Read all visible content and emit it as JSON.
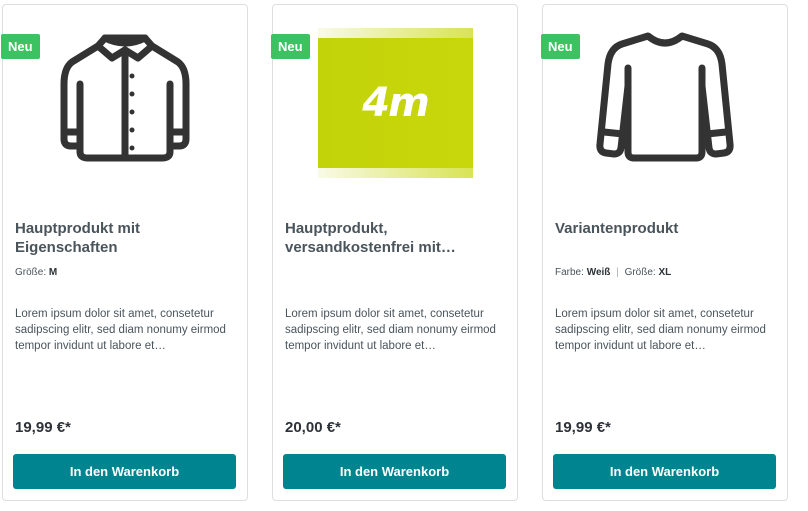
{
  "badge_label": "Neu",
  "buy_button_label": "In den Warenkorb",
  "colors": {
    "badge": "#3cc261",
    "button": "#008490",
    "logo_background": "#c3d30a"
  },
  "products": [
    {
      "title": "Hauptprodukt mit Eigenschaften",
      "icon": "jacket-icon",
      "properties": [
        {
          "label": "Größe:",
          "value": "M"
        }
      ],
      "description": "Lorem ipsum dolor sit amet, consetetur sadipscing elitr, sed diam nonumy eirmod tempor invidunt ut labore et…",
      "price": "19,99 €*"
    },
    {
      "title": "Hauptprodukt, versandkostenfrei mit…",
      "icon": "brand-logo-image",
      "logo_text": "4m",
      "properties": [],
      "description": "Lorem ipsum dolor sit amet, consetetur sadipscing elitr, sed diam nonumy eirmod tempor invidunt ut labore et…",
      "price": "20,00 €*"
    },
    {
      "title": "Variantenprodukt",
      "icon": "longsleeve-shirt-icon",
      "properties": [
        {
          "label": "Farbe:",
          "value": "Weiß"
        },
        {
          "label": "Größe:",
          "value": "XL"
        }
      ],
      "description": "Lorem ipsum dolor sit amet, consetetur sadipscing elitr, sed diam nonumy eirmod tempor invidunt ut labore et…",
      "price": "19,99 €*"
    }
  ]
}
